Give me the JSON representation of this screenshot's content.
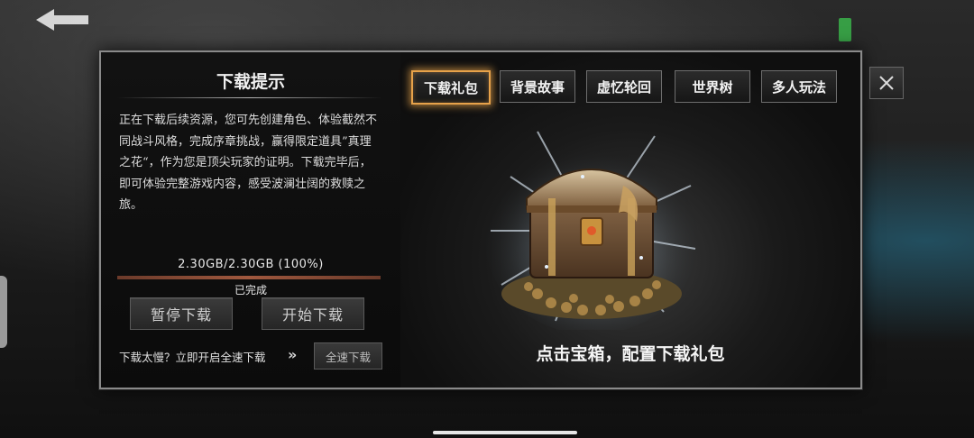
{
  "left_panel": {
    "title": "下载提示",
    "description": "正在下载后续资源，您可先创建角色、体验截然不同战斗风格，完成序章挑战，赢得限定道具”真理之花“，作为您是顶尖玩家的证明。下载完毕后，即可体验完整游戏内容，感受波澜壮阔的救赎之旅。",
    "size_text": "2.30GB/2.30GB (100%)",
    "progress_fraction": 1.0,
    "status": "已完成",
    "pause_button": "暂停下载",
    "start_button": "开始下载",
    "slow_prompt": "下载太慢？立即开启全速下载",
    "fast_button": "全速下载"
  },
  "tabs": [
    {
      "label": "下载礼包",
      "active": true
    },
    {
      "label": "背景故事",
      "active": false
    },
    {
      "label": "虚忆轮回",
      "active": false
    },
    {
      "label": "世界树",
      "active": false
    },
    {
      "label": "多人玩法",
      "active": false
    }
  ],
  "main": {
    "cta": "点击宝箱，配置下载礼包"
  },
  "icons": {
    "back": "back-arrow-icon",
    "close": "close-icon",
    "chevron": "double-chevron-right-icon",
    "chest": "treasure-chest-icon"
  },
  "colors": {
    "active_tab_glow": "#e7a24a",
    "progress": "#a0583e"
  }
}
